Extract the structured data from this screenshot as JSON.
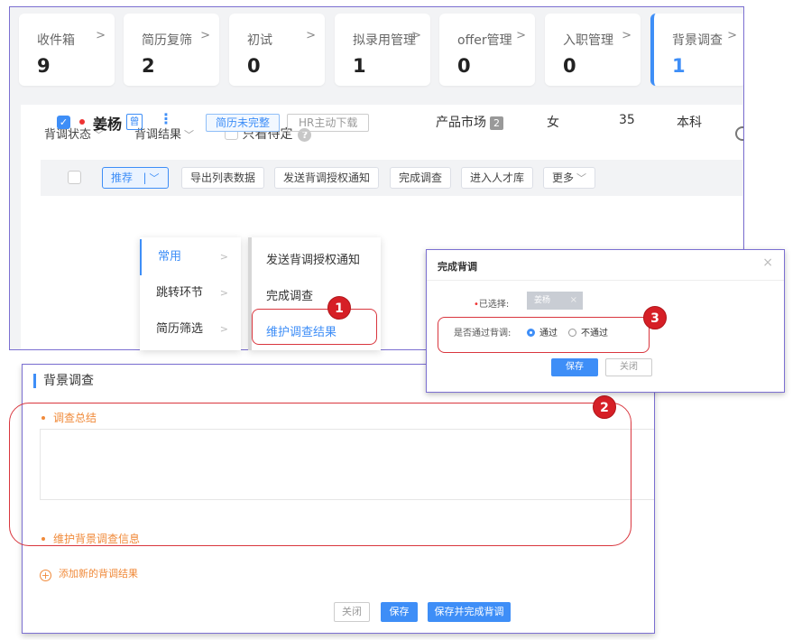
{
  "stat_tabs": [
    {
      "label": "收件箱",
      "count": "9"
    },
    {
      "label": "简历复筛",
      "count": "2"
    },
    {
      "label": "初试",
      "count": "0"
    },
    {
      "label": "拟录用管理",
      "count": "1"
    },
    {
      "label": "offer管理",
      "count": "0"
    },
    {
      "label": "入职管理",
      "count": "0"
    },
    {
      "label": "背景调查",
      "count": "1"
    }
  ],
  "filters": {
    "status": "背调状态",
    "result": "背调结果",
    "only_pending": "只看待定",
    "help_glyph": "?"
  },
  "toolbar": {
    "recommend": "推荐",
    "export": "导出列表数据",
    "send_auth": "发送背调授权通知",
    "complete": "完成调查",
    "talent_pool": "进入人才库",
    "more": "更多"
  },
  "candidate": {
    "name": "姜杨",
    "badge": "曾",
    "tag_incomplete": "简历未完整",
    "tag_hr_download": "HR主动下载",
    "position": "产品市场",
    "position_count": "2",
    "gender": "女",
    "age": "35",
    "education": "本科"
  },
  "context_menu": {
    "groups": [
      "常用",
      "跳转环节",
      "简历筛选"
    ],
    "actions": [
      "发送背调授权通知",
      "完成调查",
      "维护调查结果"
    ]
  },
  "dialog": {
    "title": "完成背调",
    "selected_label": "已选择:",
    "selected_value": "姜杨",
    "pass_label": "是否通过背调:",
    "opt_pass": "通过",
    "opt_fail": "不通过",
    "save": "保存",
    "close": "关闭"
  },
  "bg_form": {
    "title": "背景调查",
    "summary_label": "调查总结",
    "maintain_label": "维护背景调查信息",
    "add_link": "添加新的背调结果",
    "close": "关闭",
    "save": "保存",
    "save_complete": "保存并完成背调"
  },
  "annotations": [
    "1",
    "2",
    "3"
  ],
  "colors": {
    "accent": "#3e8ef7",
    "annotation": "#d61f26",
    "section_label": "#f08a3a",
    "frame": "#7b6fd1"
  }
}
